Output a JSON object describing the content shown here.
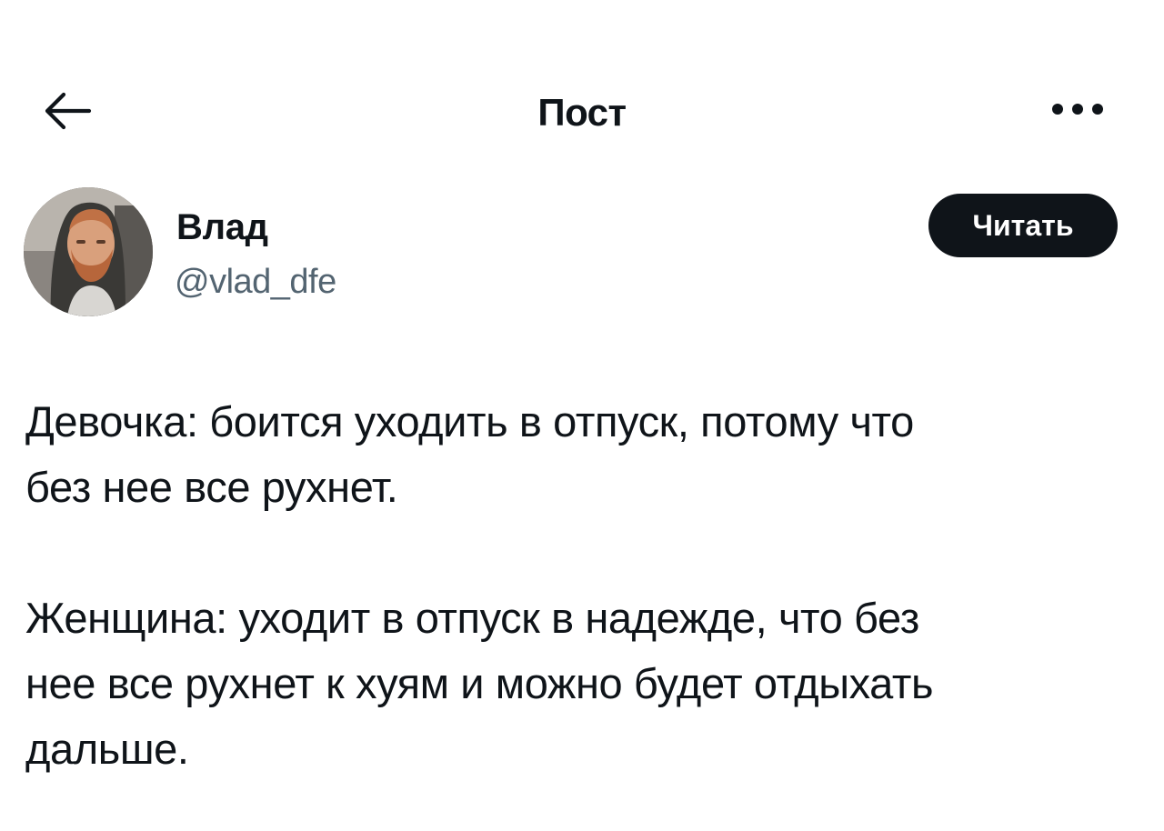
{
  "header": {
    "title": "Пост",
    "back_icon": "arrow-left-icon",
    "more_icon": "ellipsis-horizontal-icon"
  },
  "author": {
    "name": "Влад",
    "handle": "@vlad_dfe",
    "follow_label": "Читать"
  },
  "post": {
    "paragraph_1": "Девочка: боится уходить в отпуск, потому что\nбез нее все рухнет.",
    "paragraph_2": "Женщина: уходит в отпуск в надежде, что без\nнее все рухнет к хуям и можно будет отдыхать\nдальше."
  },
  "colors": {
    "text": "#0f1419",
    "secondary_text": "#536471",
    "follow_button_bg": "#0f1419",
    "background": "#ffffff"
  }
}
